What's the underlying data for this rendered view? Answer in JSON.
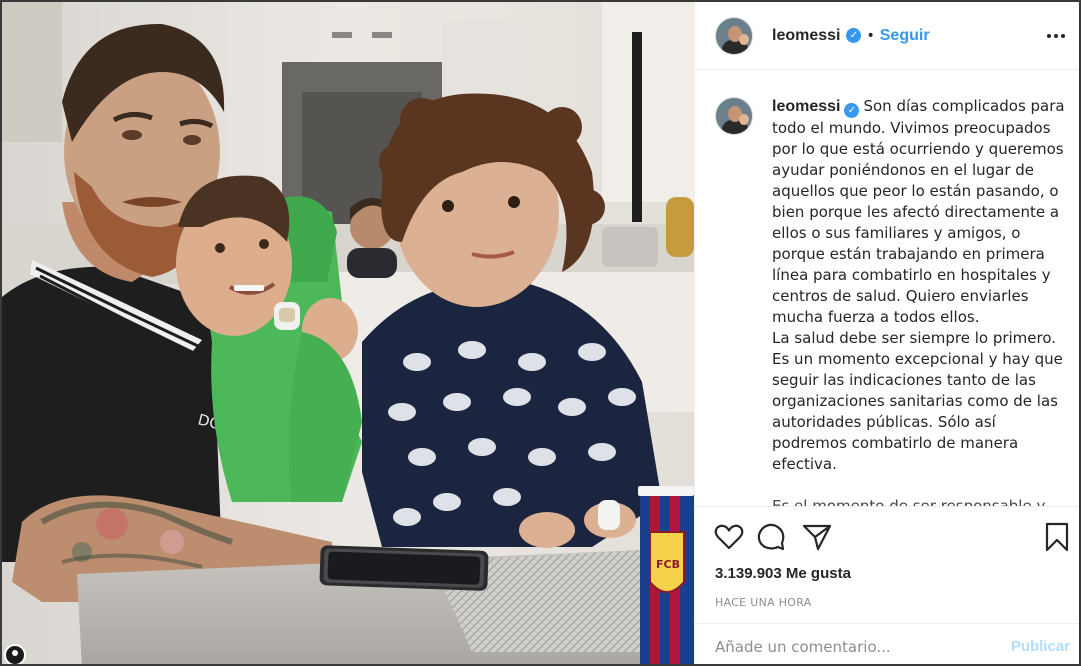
{
  "post": {
    "author": "leomessi",
    "verified_icon": "verified-badge-icon",
    "separator": "•",
    "follow_label": "Seguir",
    "more_icon": "more-options-icon"
  },
  "caption": {
    "author": "leomessi",
    "lines": [
      "Son días complicados para todo el mundo. Vivimos preocupados por lo que está ocurriendo y queremos ayudar poniéndonos en el lugar de aquellos que peor lo están pasando, o bien porque les afectó directamente a ellos o sus familiares y amigos, o porque están trabajando en primera línea para combatirlo en hospitales y centros de salud. Quiero enviarles mucha fuerza a todos ellos.",
      "La salud debe ser siempre lo primero. Es un momento excepcional y hay que seguir las indicaciones tanto de las organizaciones sanitarias como de las autoridades públicas. Sólo así podremos combatirlo de manera efectiva.",
      "Es el momento de ser responsable y"
    ]
  },
  "actions": {
    "like_icon": "heart-icon",
    "comment_icon": "comment-icon",
    "share_icon": "share-icon",
    "save_icon": "bookmark-icon",
    "likes_count": "3.139.903",
    "likes_label": "Me gusta",
    "timestamp": "HACE UNA HORA"
  },
  "comment_box": {
    "placeholder": "Añade un comentario...",
    "publish_label": "Publicar"
  },
  "photo": {
    "cup_text": "FCB",
    "shirt_text": "DOLCE&"
  },
  "colors": {
    "link_blue": "#3897f0",
    "verified_blue": "#3897f0",
    "publish_disabled": "#b2dffc",
    "muted_text": "#8e8e8e",
    "border": "#efefef"
  }
}
